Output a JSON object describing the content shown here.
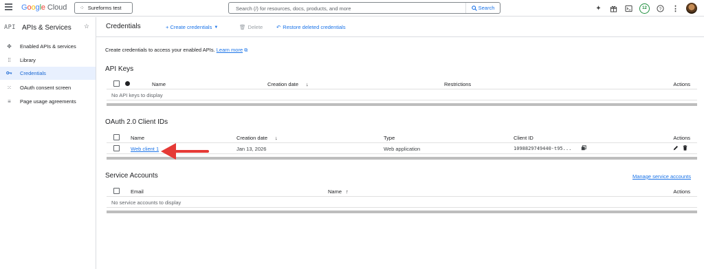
{
  "topbar": {
    "brand": "Google Cloud",
    "project": "Sureforms test",
    "search_placeholder": "Search (/) for resources, docs, products, and more",
    "search_button": "Search",
    "notification_count": "12"
  },
  "sidebar": {
    "section_mark": "API",
    "title": "APIs & Services",
    "items": [
      {
        "label": "Enabled APIs & services",
        "icon": "enabled-apis-icon"
      },
      {
        "label": "Library",
        "icon": "library-icon"
      },
      {
        "label": "Credentials",
        "icon": "key-icon",
        "active": true
      },
      {
        "label": "OAuth consent screen",
        "icon": "consent-icon"
      },
      {
        "label": "Page usage agreements",
        "icon": "settings-list-icon"
      }
    ]
  },
  "header": {
    "title": "Credentials",
    "create": "+ Create credentials",
    "delete": "Delete",
    "restore": "Restore deleted credentials"
  },
  "intro": {
    "text": "Create credentials to access your enabled APIs.",
    "learn_more": "Learn more"
  },
  "api_keys": {
    "title": "API Keys",
    "columns": {
      "name": "Name",
      "creation": "Creation date",
      "restrictions": "Restrictions",
      "actions": "Actions"
    },
    "empty": "No API keys to display"
  },
  "oauth": {
    "title": "OAuth 2.0 Client IDs",
    "columns": {
      "name": "Name",
      "creation": "Creation date",
      "type": "Type",
      "client_id": "Client ID",
      "actions": "Actions"
    },
    "rows": [
      {
        "name": "Web client 1",
        "creation": "Jan 13, 2026",
        "type": "Web application",
        "client_id": "1098829749440-t95..."
      }
    ]
  },
  "service_accounts": {
    "title": "Service Accounts",
    "manage": "Manage service accounts",
    "columns": {
      "email": "Email",
      "name": "Name",
      "actions": "Actions"
    },
    "empty": "No service accounts to display"
  },
  "colors": {
    "accent": "#1a73e8",
    "active_bg": "#e8f0fe",
    "arrow": "#e53935"
  }
}
